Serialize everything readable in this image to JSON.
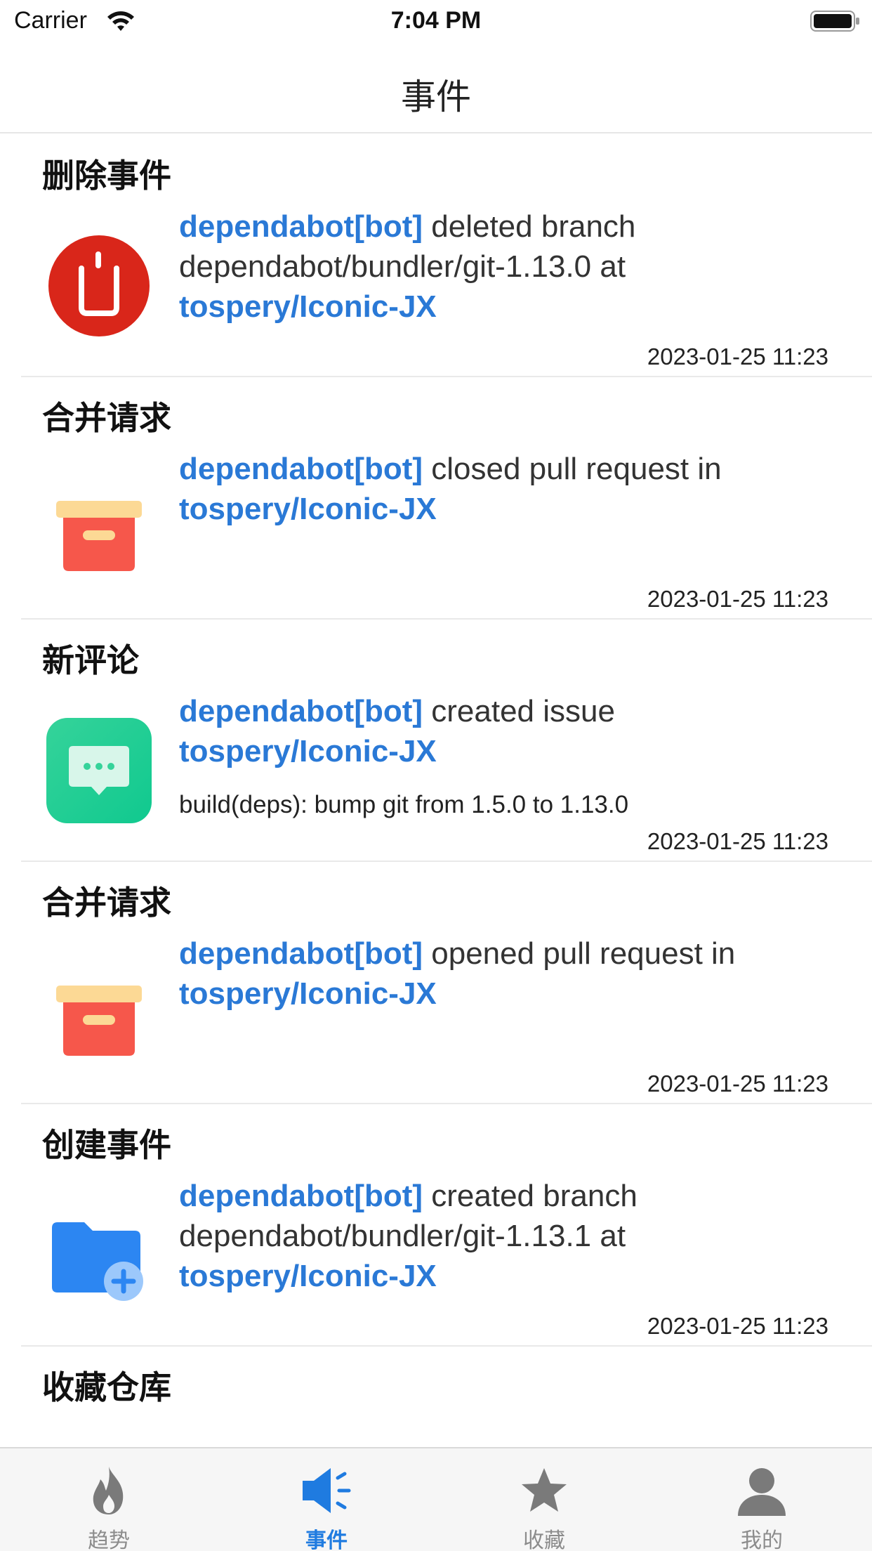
{
  "status_bar": {
    "carrier": "Carrier",
    "time": "7:04 PM",
    "icons": [
      "wifi-icon",
      "battery-icon"
    ]
  },
  "nav": {
    "title": "事件"
  },
  "events": [
    {
      "type": "删除事件",
      "icon": "delete-icon",
      "actor": "dependabot[bot]",
      "action": " deleted branch dependabot/bundler/git-1.13.0 at ",
      "repo": "tospery/Iconic-JX",
      "body": "",
      "time": "2023-01-25 11:23"
    },
    {
      "type": "合并请求",
      "icon": "archive-box-icon",
      "actor": "dependabot[bot]",
      "action": " closed pull request  in ",
      "repo": "tospery/Iconic-JX",
      "body": "",
      "time": "2023-01-25 11:23"
    },
    {
      "type": "新评论",
      "icon": "comment-bubble-icon",
      "actor": "dependabot[bot]",
      "action": " created issue ",
      "repo": "tospery/Iconic-JX",
      "body": "build(deps): bump git from 1.5.0 to 1.13.0",
      "time": "2023-01-25 11:23"
    },
    {
      "type": "合并请求",
      "icon": "archive-box-icon",
      "actor": "dependabot[bot]",
      "action": " opened pull request  in ",
      "repo": "tospery/Iconic-JX",
      "body": "",
      "time": "2023-01-25 11:23"
    },
    {
      "type": "创建事件",
      "icon": "folder-add-icon",
      "actor": "dependabot[bot]",
      "action": " created branch dependabot/bundler/git-1.13.1 at ",
      "repo": "tospery/Iconic-JX",
      "body": "",
      "time": "2023-01-25 11:23"
    },
    {
      "type": "收藏仓库",
      "icon": "star-repo-icon",
      "actor": "",
      "action": "",
      "repo": "",
      "body": "",
      "time": ""
    }
  ],
  "tabs": [
    {
      "label": "趋势",
      "icon": "flame-icon",
      "active": false
    },
    {
      "label": "事件",
      "icon": "megaphone-icon",
      "active": true
    },
    {
      "label": "收藏",
      "icon": "star-icon",
      "active": false
    },
    {
      "label": "我的",
      "icon": "user-icon",
      "active": false
    }
  ],
  "colors": {
    "accent": "#2a79d6",
    "tab_active": "#1f7be0",
    "tab_inactive": "#8c8c8c"
  }
}
